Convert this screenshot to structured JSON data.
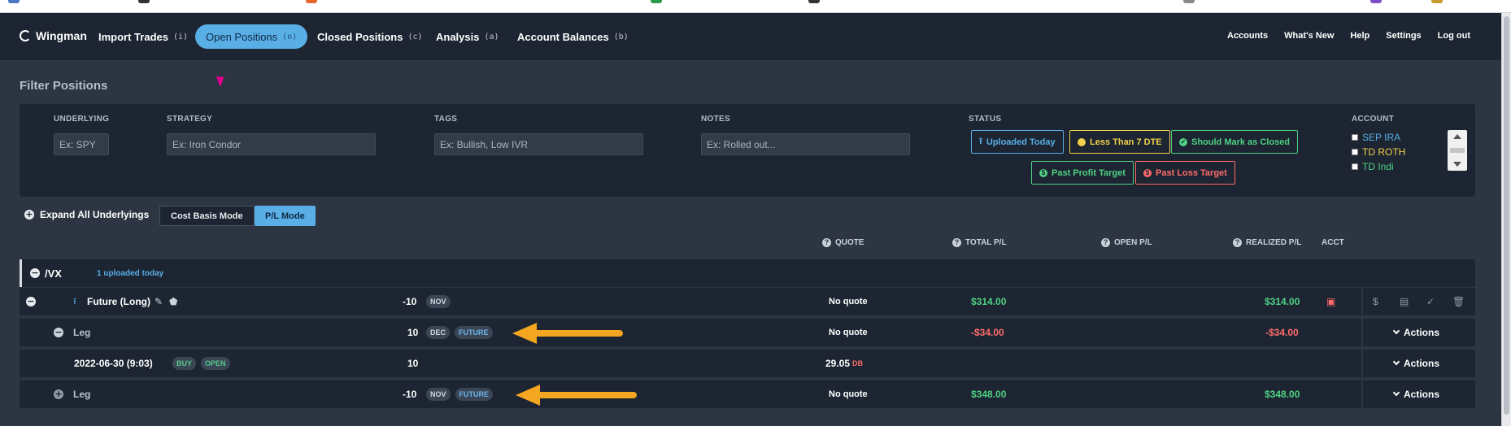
{
  "nav": {
    "brand": "Wingman",
    "items": [
      {
        "label": "Import Trades",
        "key": "(i)"
      },
      {
        "label": "Open Positions",
        "key": "(o)"
      },
      {
        "label": "Closed Positions",
        "key": "(c)"
      },
      {
        "label": "Analysis",
        "key": "(a)"
      },
      {
        "label": "Account Balances",
        "key": "(b)"
      }
    ],
    "right": [
      "Accounts",
      "What's New",
      "Help",
      "Settings",
      "Log out"
    ]
  },
  "page_title": "Filter Positions",
  "filters": {
    "underlying": {
      "label": "UNDERLYING",
      "placeholder": "Ex: SPY"
    },
    "strategy": {
      "label": "STRATEGY",
      "placeholder": "Ex: Iron Condor"
    },
    "tags": {
      "label": "TAGS",
      "placeholder": "Ex: Bullish, Low IVR"
    },
    "notes": {
      "label": "NOTES",
      "placeholder": "Ex: Rolled out..."
    },
    "status": {
      "label": "STATUS",
      "buttons": [
        "Uploaded Today",
        "Less Than 7 DTE",
        "Should Mark as Closed",
        "Past Profit Target",
        "Past Loss Target"
      ]
    },
    "account": {
      "label": "ACCOUNT",
      "options": [
        "SEP IRA",
        "TD ROTH",
        "TD Indi"
      ]
    }
  },
  "controls": {
    "expand_all": "Expand All Underlyings",
    "cost_basis_mode": "Cost Basis Mode",
    "pl_mode": "P/L Mode"
  },
  "table": {
    "headers": {
      "quote": "QUOTE",
      "total_pl": "TOTAL P/L",
      "open_pl": "OPEN P/L",
      "realized_pl": "REALIZED P/L",
      "acct": "ACCT"
    },
    "group": {
      "symbol": "/VX",
      "note": "1 uploaded today"
    },
    "position": {
      "name": "Future (Long)",
      "qty": "-10",
      "month": "NOV",
      "quote": "No quote",
      "total_pl": "$314.00",
      "realized_pl": "$314.00"
    },
    "leg1": {
      "name": "Leg",
      "qty": "10",
      "month": "DEC",
      "type": "FUTURE",
      "quote": "No quote",
      "total_pl": "-$34.00",
      "realized_pl": "-$34.00",
      "actions": "Actions"
    },
    "fill": {
      "date": "2022-06-30 (9:03)",
      "side": "BUY",
      "effect": "OPEN",
      "qty": "10",
      "price": "29.05",
      "price_suffix": "DB",
      "actions": "Actions"
    },
    "leg2": {
      "name": "Leg",
      "qty": "-10",
      "month": "NOV",
      "type": "FUTURE",
      "quote": "No quote",
      "total_pl": "$348.00",
      "realized_pl": "$348.00",
      "actions": "Actions"
    }
  },
  "colors": {
    "accent": "#5aaee6",
    "profit": "#4fd183",
    "loss": "#ff6b6b",
    "warning": "#f2d04b",
    "arrow": "#f4a621"
  }
}
